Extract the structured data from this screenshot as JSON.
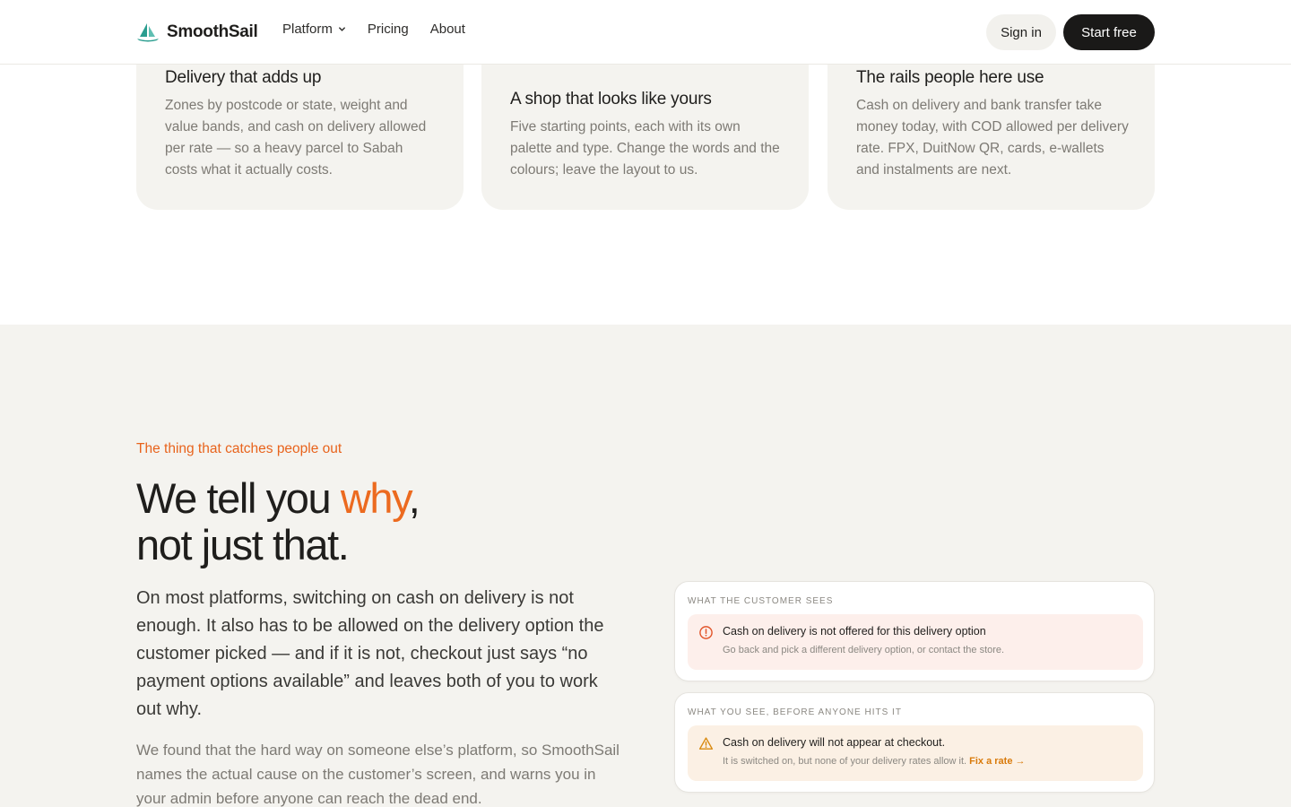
{
  "header": {
    "brand": "SmoothSail",
    "nav": {
      "platform": "Platform",
      "pricing": "Pricing",
      "about": "About"
    },
    "sign_in": "Sign in",
    "start_free": "Start free"
  },
  "features": [
    {
      "title": "Delivery that adds up",
      "body": "Zones by postcode or state, weight and value bands, and cash on delivery allowed per rate — so a heavy parcel to Sabah costs what it actually costs."
    },
    {
      "title": "A shop that looks like yours",
      "body": "Five starting points, each with its own palette and type. Change the words and the colours; leave the layout to us."
    },
    {
      "title": "The rails people here use",
      "body": "Cash on delivery and bank transfer take money today, with COD allowed per delivery rate. FPX, DuitNow QR, cards, e-wallets and instalments are next."
    }
  ],
  "section": {
    "eyebrow": "The thing that catches people out",
    "headline": {
      "part1": "We tell you ",
      "accent": "why",
      "part2": ",",
      "line2": "not just that."
    },
    "lede": "On most platforms, switching on cash on delivery is not enough. It also has to be allowed on the delivery option the customer picked — and if it is not, checkout just says “no payment options available” and leaves both of you to work out why.",
    "sub": "We found that the hard way on someone else’s platform, so SmoothSail names the actual cause on the customer’s screen, and warns you in your admin before anyone can reach the dead end."
  },
  "customer_panel": {
    "label": "What the customer sees",
    "title": "Cash on delivery is not offered for this delivery option",
    "body": "Go back and pick a different delivery option, or contact the store."
  },
  "admin_panel": {
    "label": "What you see, before anyone hits it",
    "title": "Cash on delivery will not appear at checkout.",
    "body": "It is switched on, but none of your delivery rates allow it. ",
    "link": "Fix a rate →"
  },
  "colors": {
    "accent": "#ec6a1f",
    "brand_teal": "#2a9d8f",
    "dark_button": "#1a1918",
    "section_bg": "#f4f3ef",
    "error_bg": "#fdefeb",
    "warn_bg": "#fbf0e4",
    "warn_link": "#d97a0a"
  },
  "icons": {
    "logo": "sailboat-icon",
    "nav_dropdown": "chevron-down-icon",
    "error": "alert-circle-icon",
    "warning": "warning-triangle-icon"
  }
}
